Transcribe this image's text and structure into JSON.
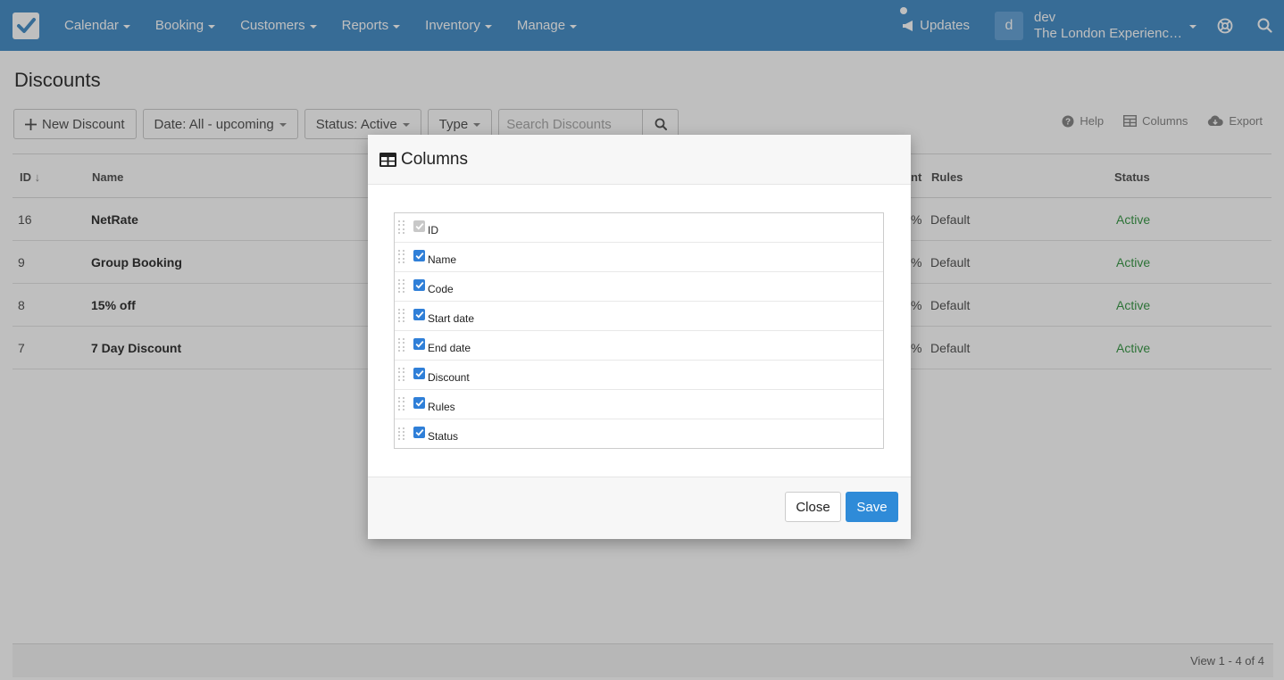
{
  "nav": {
    "items": [
      "Calendar",
      "Booking",
      "Customers",
      "Reports",
      "Inventory",
      "Manage"
    ],
    "updates_label": "Updates",
    "avatar_letter": "d",
    "user_name": "dev",
    "company": "The London Experienc…"
  },
  "page": {
    "title": "Discounts",
    "new_button": "New Discount",
    "date_filter": "Date: All - upcoming",
    "status_filter": "Status: Active",
    "type_filter": "Type",
    "search_placeholder": "Search Discounts",
    "help": "Help",
    "columns": "Columns",
    "export": "Export"
  },
  "table": {
    "headers": {
      "id": "ID",
      "name": "Name",
      "discount": "nt",
      "rules": "Rules",
      "status": "Status"
    },
    "rows": [
      {
        "id": "16",
        "name": "NetRate",
        "discount": "%",
        "rules": "Default",
        "status": "Active"
      },
      {
        "id": "9",
        "name": "Group Booking",
        "discount": "%",
        "rules": "Default",
        "status": "Active"
      },
      {
        "id": "8",
        "name": "15% off",
        "discount": "%",
        "rules": "Default",
        "status": "Active"
      },
      {
        "id": "7",
        "name": "7 Day Discount",
        "discount": "%",
        "rules": "Default",
        "status": "Active"
      }
    ]
  },
  "footer": {
    "pagination": "View 1 - 4 of 4"
  },
  "modal": {
    "title": "Columns",
    "columns": [
      {
        "label": "ID",
        "checked": true,
        "disabled": true
      },
      {
        "label": "Name",
        "checked": true,
        "disabled": false
      },
      {
        "label": "Code",
        "checked": true,
        "disabled": false
      },
      {
        "label": "Start date",
        "checked": true,
        "disabled": false
      },
      {
        "label": "End date",
        "checked": true,
        "disabled": false
      },
      {
        "label": "Discount",
        "checked": true,
        "disabled": false
      },
      {
        "label": "Rules",
        "checked": true,
        "disabled": false
      },
      {
        "label": "Status",
        "checked": true,
        "disabled": false
      }
    ],
    "close_label": "Close",
    "save_label": "Save"
  },
  "colors": {
    "nav": "#4a90c9",
    "primary": "#2f8bd8",
    "status_active": "#3c9a4a"
  }
}
